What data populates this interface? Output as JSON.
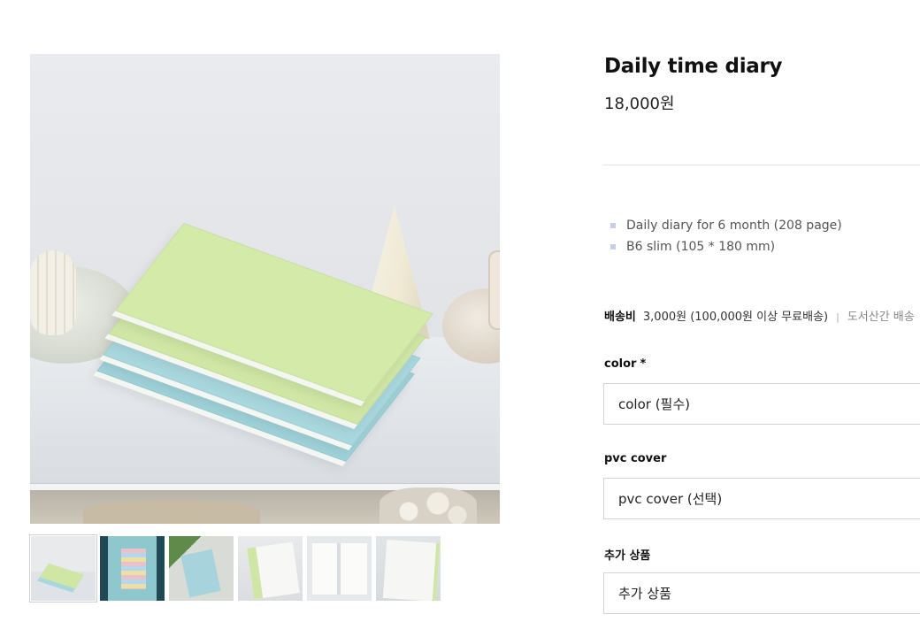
{
  "product": {
    "title": "Daily time diary",
    "price": "18,000원",
    "specs": [
      "Daily diary for 6 month (208 page)",
      "B6 slim (105 * 180 mm)"
    ],
    "main_image_icon": "product-photo-diaries-on-shelf"
  },
  "thumbnails": [
    {
      "icon": "thumb-diaries-stack",
      "active": true
    },
    {
      "icon": "thumb-blue-diary-stickers",
      "active": false
    },
    {
      "icon": "thumb-blue-diary-plant",
      "active": false
    },
    {
      "icon": "thumb-open-white-diary",
      "active": false
    },
    {
      "icon": "thumb-diary-inner-pages",
      "active": false
    },
    {
      "icon": "thumb-diary-with-clear-cover",
      "active": false
    }
  ],
  "shipping": {
    "label": "배송비",
    "value": "3,000원 (100,000원 이상 무료배송)",
    "separator": "|",
    "extra": "도서산간 배송"
  },
  "options": {
    "color": {
      "label": "color",
      "required_mark": "*",
      "placeholder": "color (필수)"
    },
    "pvc_cover": {
      "label": "pvc cover",
      "placeholder": "pvc cover (선택)"
    },
    "addon": {
      "label": "추가 상품",
      "placeholder": "추가 상품"
    }
  },
  "colors": {
    "divider": "#e2e2e2",
    "bullet": "#c7cdea",
    "select_border": "#d4d4d4"
  }
}
